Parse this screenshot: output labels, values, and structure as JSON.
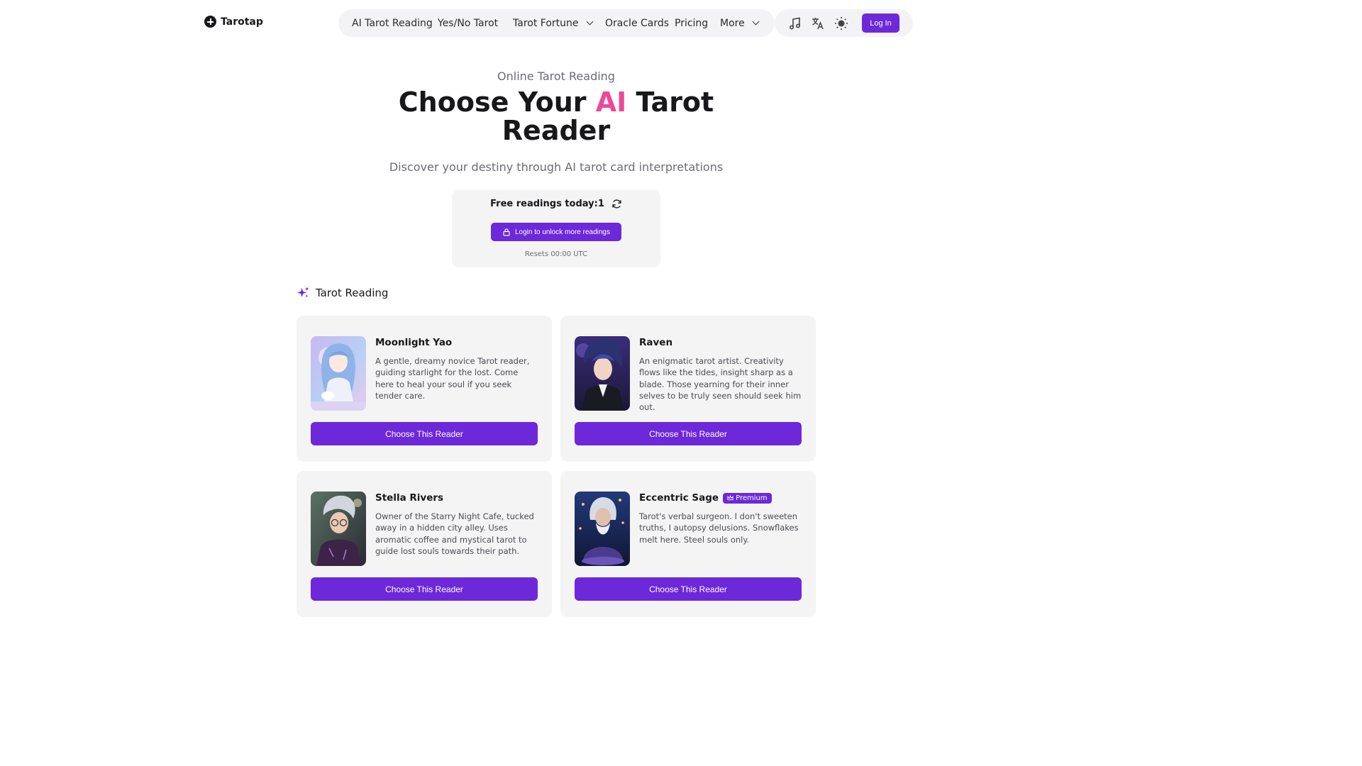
{
  "brand": {
    "name": "Tarotap"
  },
  "nav": {
    "items": [
      {
        "label": "AI Tarot Reading"
      },
      {
        "label": "Yes/No Tarot"
      },
      {
        "label": "Tarot Fortune"
      },
      {
        "label": "Oracle Cards"
      },
      {
        "label": "Pricing"
      },
      {
        "label": "More"
      }
    ]
  },
  "toolbar": {
    "music_icon": "music-note-icon",
    "language_icon": "translate-icon",
    "theme_icon": "sun-icon",
    "login_label": "Log In"
  },
  "hero": {
    "eyebrow": "Online Tarot Reading",
    "title_before": "Choose Your ",
    "title_accent": "AI",
    "title_after": " Tarot Reader",
    "subtitle": "Discover your destiny through AI tarot card interpretations"
  },
  "quota": {
    "label": "Free readings today:",
    "count": "1",
    "unlock_label": "Login to unlock more readings",
    "reset_text": "Resets 00:00 UTC"
  },
  "section": {
    "title": "Tarot Reading"
  },
  "readers": [
    {
      "name": "Moonlight Yao",
      "description": "A gentle, dreamy novice Tarot reader, guiding starlight for the lost. Come here to heal your soul if you seek tender care.",
      "button": "Choose This Reader"
    },
    {
      "name": "Raven",
      "description": "An enigmatic tarot artist. Creativity flows like the tides, insight sharp as a blade. Those yearning for their inner selves to be truly seen should seek him out.",
      "button": "Choose This Reader"
    },
    {
      "name": "Stella Rivers",
      "description": "Owner of the Starry Night Cafe, tucked away in a hidden city alley. Uses aromatic coffee and mystical tarot to guide lost souls towards their path.",
      "button": "Choose This Reader"
    },
    {
      "name": "Eccentric Sage",
      "badge": "Premium",
      "description": "Tarot's verbal surgeon. I don't sweeten truths, I autopsy delusions. Snowflakes melt here. Steel souls only.",
      "button": "Choose This Reader"
    }
  ],
  "colors": {
    "accent": "#6d28d9",
    "highlight": "#ec4899"
  }
}
